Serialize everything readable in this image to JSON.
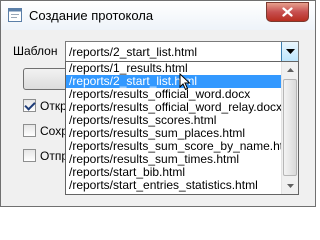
{
  "window": {
    "title": "Создание протокола"
  },
  "form": {
    "template_label": "Шаблон",
    "template_value": "/reports/2_start_list.html",
    "checkboxes": [
      {
        "label": "Откры",
        "checked": true
      },
      {
        "label": "Сохра",
        "checked": false
      },
      {
        "label": "Отпра",
        "checked": false
      }
    ]
  },
  "dropdown": {
    "items": [
      "/reports/1_results.html",
      "/reports/2_start_list.html",
      "/reports/results_official_word.docx",
      "/reports/results_official_word_relay.docx",
      "/reports/results_scores.html",
      "/reports/results_sum_places.html",
      "/reports/results_sum_score_by_name.html",
      "/reports/results_sum_times.html",
      "/reports/start_bib.html",
      "/reports/start_entries_statistics.html"
    ],
    "selected_index": 1
  },
  "icons": {
    "app": "app-window-icon",
    "close": "close-icon",
    "dropdown": "chevron-down-icon"
  },
  "colors": {
    "selection": "#3399ff",
    "close_button": "#c75050"
  }
}
